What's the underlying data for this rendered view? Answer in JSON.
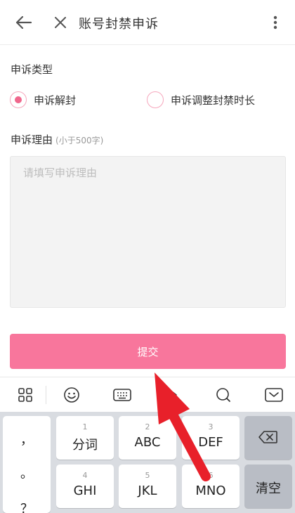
{
  "header": {
    "title": "账号封禁申诉"
  },
  "appeal_type": {
    "label": "申诉类型",
    "options": [
      {
        "label": "申诉解封",
        "checked": true
      },
      {
        "label": "申诉调整封禁时长",
        "checked": false
      }
    ]
  },
  "reason": {
    "label": "申诉理由",
    "hint": "(小于500字)",
    "placeholder": "请填写申诉理由",
    "value": ""
  },
  "submit_label": "提交",
  "colors": {
    "accent": "#f8769c",
    "radio_dot": "#f0668c",
    "arrow": "#e8202a"
  },
  "keyboard": {
    "toolbar_icons": [
      "grid-icon",
      "emoji-icon",
      "keyboard-icon",
      "cursor-icon",
      "search-icon",
      "collapse-icon"
    ],
    "punctuation": [
      "，",
      "。",
      "？"
    ],
    "rows": [
      [
        {
          "num": "1",
          "label": "分词"
        },
        {
          "num": "2",
          "label": "ABC"
        },
        {
          "num": "3",
          "label": "DEF"
        }
      ],
      [
        {
          "num": "4",
          "label": "GHI"
        },
        {
          "num": "5",
          "label": "JKL"
        },
        {
          "num": "6",
          "label": "MNO"
        }
      ]
    ],
    "clear_label": "清空"
  }
}
